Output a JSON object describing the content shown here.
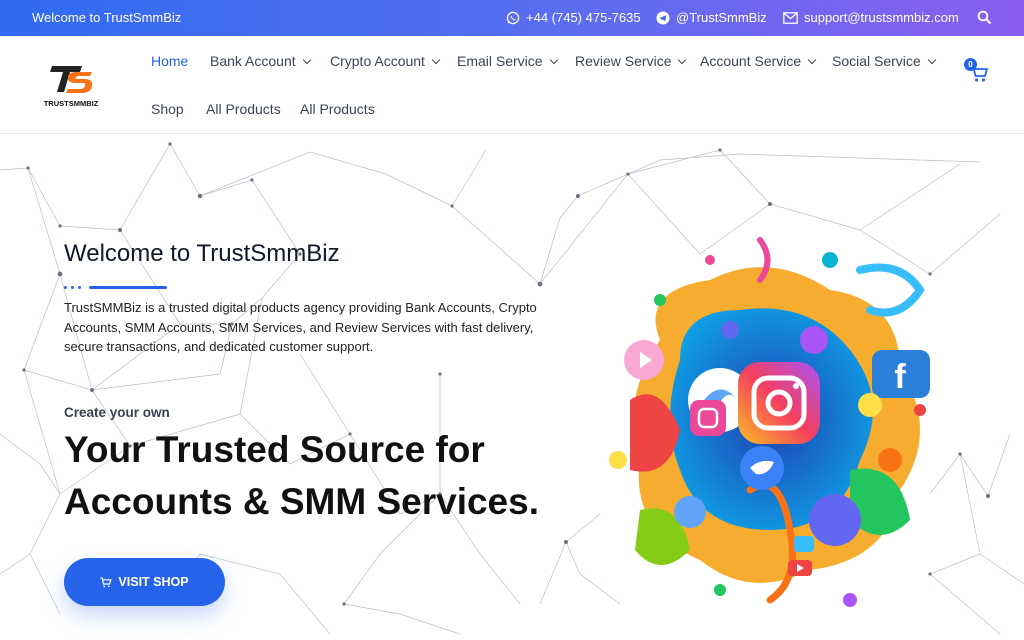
{
  "topbar": {
    "welcome": "Welcome to TrustSmmBiz",
    "phone": "+44 (745) 475-7635",
    "telegram": "@TrustSmmBiz",
    "email": "support@trustsmmbiz.com"
  },
  "header": {
    "logo_text": "TRUSTSMMBIZ",
    "nav": [
      {
        "label": "Home",
        "active": true
      },
      {
        "label": "Bank Account",
        "dropdown": true
      },
      {
        "label": "Crypto Account",
        "dropdown": true
      },
      {
        "label": "Email Service",
        "dropdown": true
      },
      {
        "label": "Review Service",
        "dropdown": true
      },
      {
        "label": "Account Service",
        "dropdown": true
      },
      {
        "label": "Social Service",
        "dropdown": true
      },
      {
        "label": "Shop"
      },
      {
        "label": "All Products"
      },
      {
        "label": "All Products"
      }
    ],
    "cart_count": "0"
  },
  "hero": {
    "title": "Welcome to TrustSmmBiz",
    "description": "TrustSMMBiz is a trusted digital products agency providing Bank Accounts, Crypto Accounts, SMM Accounts, SMM Services, and Review Services with fast delivery, secure transactions, and dedicated customer support.",
    "subheading": "Create your own",
    "headline": "Your Trusted Source for Accounts & SMM Services.",
    "cta_label": "VISIT SHOP"
  },
  "colors": {
    "accent": "#2563eb",
    "topbar_gradient_start": "#2f6bf2",
    "topbar_gradient_end": "#8a5ef0",
    "logo_orange": "#f97316"
  },
  "icons": {
    "phone": "whatsapp-icon",
    "telegram": "telegram-icon",
    "email": "envelope-icon",
    "search": "search-icon",
    "cart": "cart-icon"
  }
}
